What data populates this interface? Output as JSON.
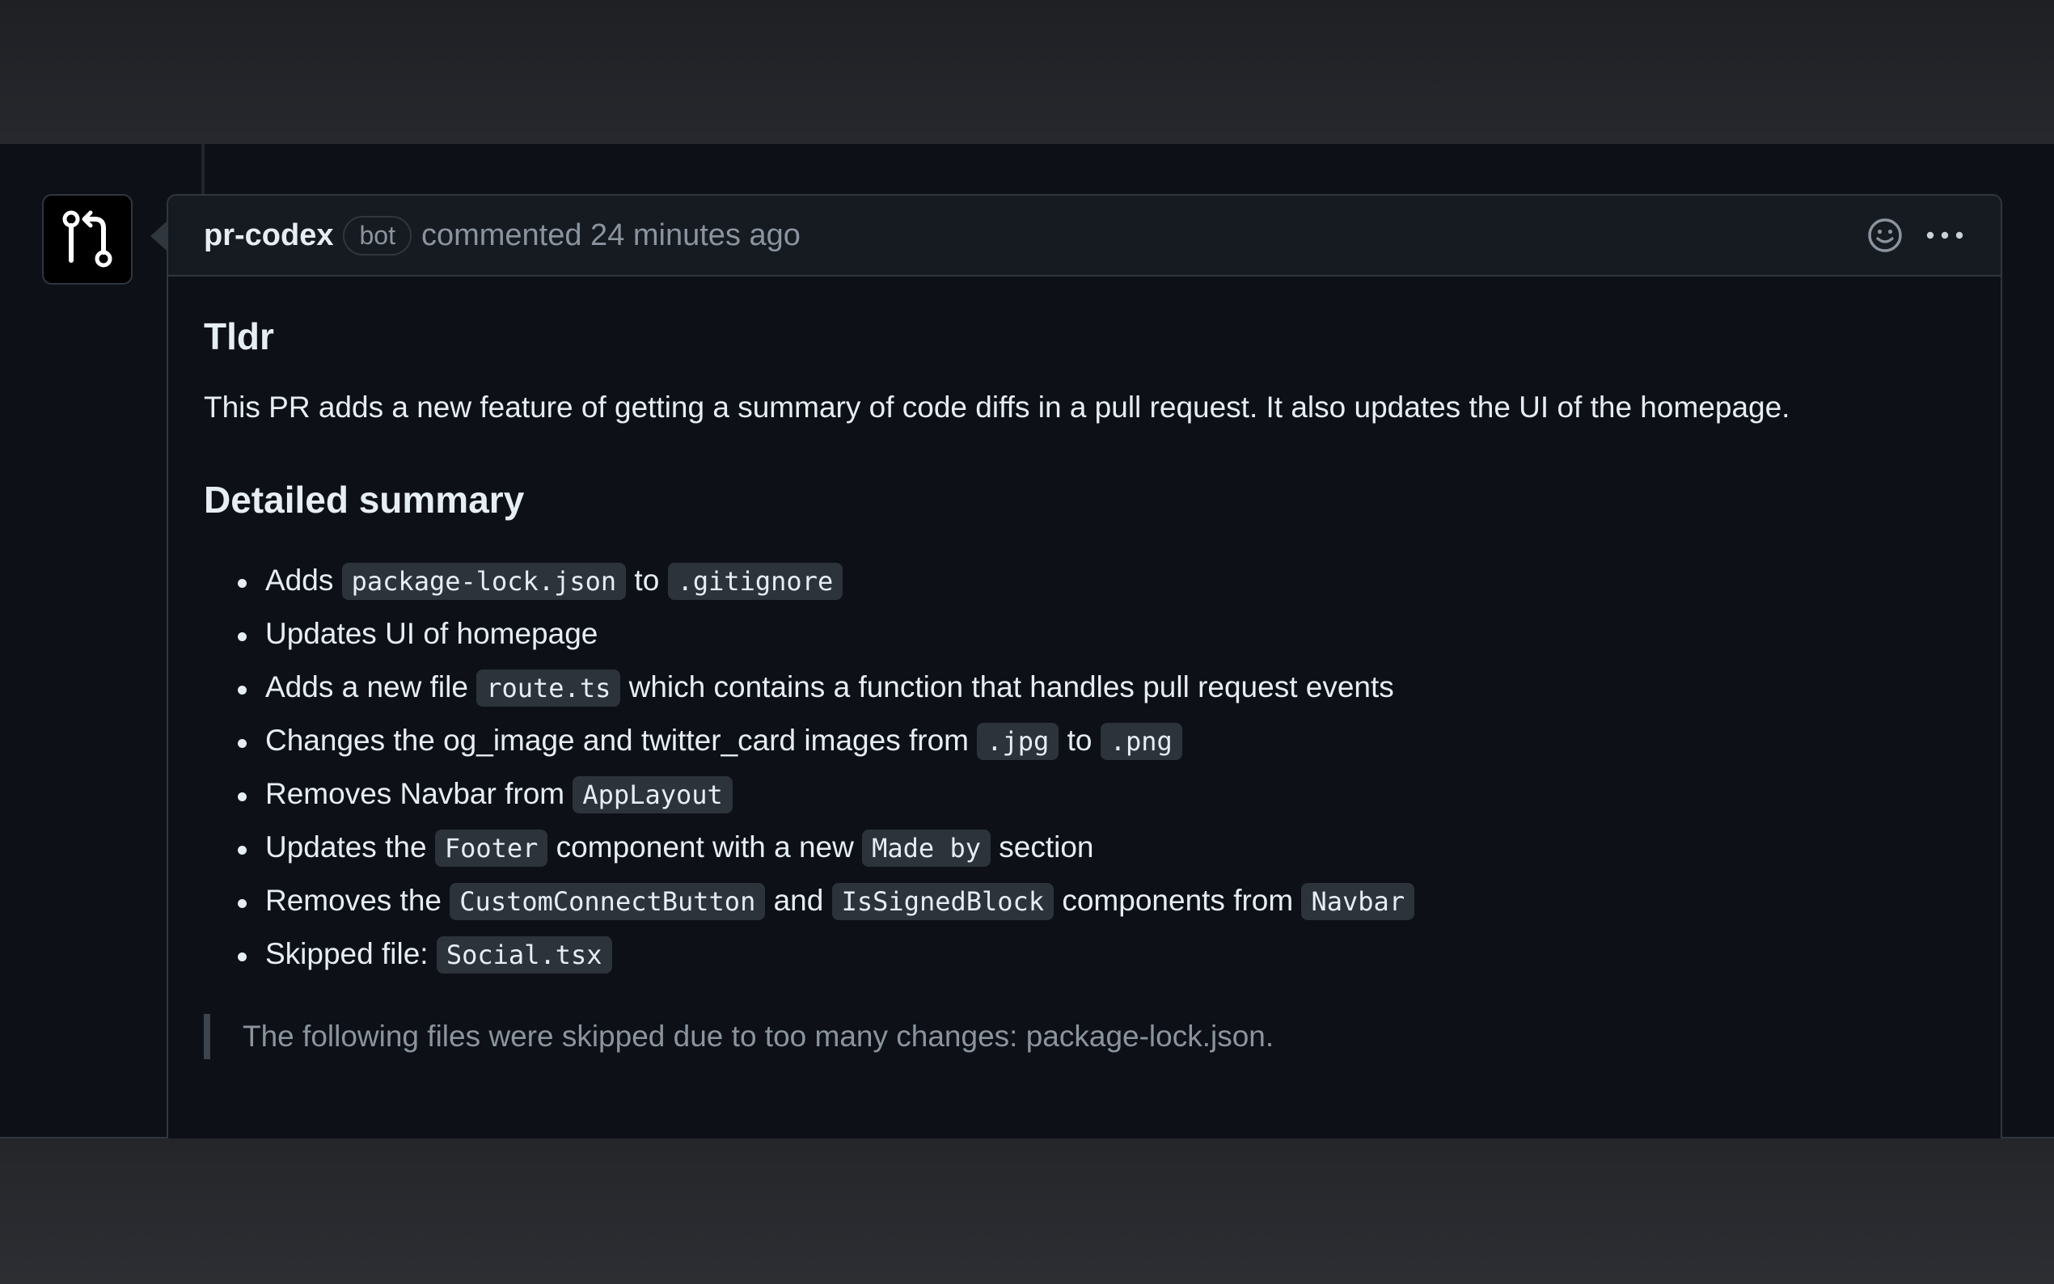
{
  "comment": {
    "author": "pr-codex",
    "badge": "bot",
    "meta": "commented 24 minutes ago",
    "avatar_icon": "git-pull-request-icon",
    "actions": [
      "smiley-icon",
      "kebab-menu-icon"
    ]
  },
  "body": {
    "title": "Tldr",
    "summary": "This PR adds a new feature of getting a summary of code diffs in a pull request. It also updates the UI of the homepage.",
    "section_title": "Detailed summary",
    "items": [
      {
        "a": "Adds ",
        "c1": "package-lock.json",
        "b": " to ",
        "c2": ".gitignore"
      },
      {
        "a": "Updates UI of homepage"
      },
      {
        "a": "Adds a new file ",
        "c1": "route.ts",
        "b": " which contains a function that handles pull request events"
      },
      {
        "a": "Changes the og_image and twitter_card images from ",
        "c1": ".jpg",
        "b": " to ",
        "c2": ".png"
      },
      {
        "a": "Removes Navbar from ",
        "c1": "AppLayout"
      },
      {
        "a": "Updates the ",
        "c1": "Footer",
        "b": " component with a new ",
        "c2": "Made by",
        "d": " section"
      },
      {
        "a": "Removes the ",
        "c1": "CustomConnectButton",
        "b": " and ",
        "c2": "IsSignedBlock",
        "d": " components from ",
        "c3": "Navbar"
      },
      {
        "a": "Skipped file: ",
        "c1": "Social.tsx"
      }
    ],
    "note": "The following files were skipped due to too many changes: package-lock.json."
  }
}
